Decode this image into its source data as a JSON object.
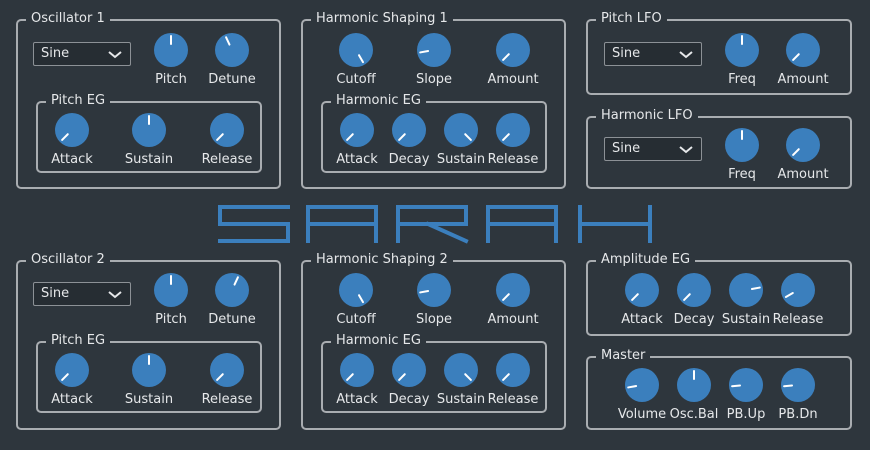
{
  "logo_text": "SARAH",
  "colors": {
    "background": "#2e363d",
    "knob": "#3b7fbd",
    "border": "#a9adb1",
    "logo": "#3b7fbd"
  },
  "osc1": {
    "title": "Oscillator 1",
    "wave": "Sine",
    "pitch": "Pitch",
    "detune": "Detune",
    "eg": {
      "title": "Pitch EG",
      "attack": "Attack",
      "sustain": "Sustain",
      "release": "Release"
    }
  },
  "osc2": {
    "title": "Oscillator 2",
    "wave": "Sine",
    "pitch": "Pitch",
    "detune": "Detune",
    "eg": {
      "title": "Pitch EG",
      "attack": "Attack",
      "sustain": "Sustain",
      "release": "Release"
    }
  },
  "hs1": {
    "title": "Harmonic Shaping 1",
    "cutoff": "Cutoff",
    "slope": "Slope",
    "amount": "Amount",
    "eg": {
      "title": "Harmonic EG",
      "attack": "Attack",
      "decay": "Decay",
      "sustain": "Sustain",
      "release": "Release"
    }
  },
  "hs2": {
    "title": "Harmonic Shaping 2",
    "cutoff": "Cutoff",
    "slope": "Slope",
    "amount": "Amount",
    "eg": {
      "title": "Harmonic EG",
      "attack": "Attack",
      "decay": "Decay",
      "sustain": "Sustain",
      "release": "Release"
    }
  },
  "pitch_lfo": {
    "title": "Pitch LFO",
    "wave": "Sine",
    "freq": "Freq",
    "amount": "Amount"
  },
  "harm_lfo": {
    "title": "Harmonic LFO",
    "wave": "Sine",
    "freq": "Freq",
    "amount": "Amount"
  },
  "amp_eg": {
    "title": "Amplitude EG",
    "attack": "Attack",
    "decay": "Decay",
    "sustain": "Sustain",
    "release": "Release"
  },
  "master": {
    "title": "Master",
    "volume": "Volume",
    "osc_bal": "Osc.Bal",
    "pb_up": "PB.Up",
    "pb_dn": "PB.Dn"
  }
}
